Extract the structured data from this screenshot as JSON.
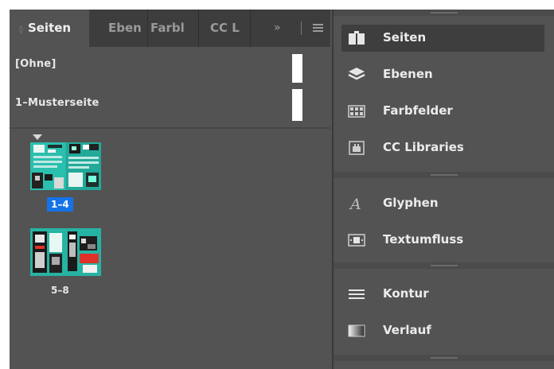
{
  "pages_panel": {
    "tabs": [
      {
        "label": "Seiten",
        "active": true
      },
      {
        "label": "Eben",
        "active": false
      },
      {
        "label": "Farbl",
        "active": false
      },
      {
        "label": "CC L",
        "active": false
      }
    ],
    "overflow_label": "»",
    "masters": [
      {
        "label": "[Ohne]"
      },
      {
        "label": "1–Musterseite"
      }
    ],
    "spreads": [
      {
        "label": "1–4",
        "selected": true
      },
      {
        "label": "5–8",
        "selected": false
      }
    ]
  },
  "dock": {
    "groups": [
      [
        {
          "label": "Seiten",
          "icon": "pages-icon",
          "active": true
        },
        {
          "label": "Ebenen",
          "icon": "layers-icon",
          "active": false
        },
        {
          "label": "Farbfelder",
          "icon": "swatches-icon",
          "active": false
        },
        {
          "label": "CC Libraries",
          "icon": "cc-libraries-icon",
          "active": false
        }
      ],
      [
        {
          "label": "Glyphen",
          "icon": "glyph-icon",
          "active": false
        },
        {
          "label": "Textumfluss",
          "icon": "text-wrap-icon",
          "active": false
        }
      ],
      [
        {
          "label": "Kontur",
          "icon": "stroke-icon",
          "active": false
        },
        {
          "label": "Verlauf",
          "icon": "gradient-icon",
          "active": false
        }
      ]
    ]
  },
  "colors": {
    "panel_bg": "#535353",
    "tabbar_bg": "#3d3d3d",
    "selection_blue": "#1473e6",
    "thumb_teal": "#27b3a3",
    "thumb_red": "#e0302a"
  }
}
